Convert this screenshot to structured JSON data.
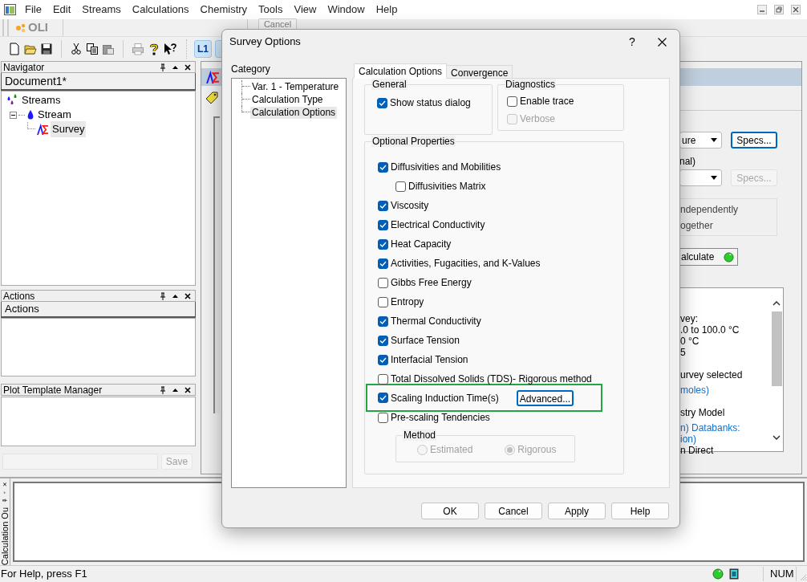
{
  "menu_bar": {
    "items": [
      "File",
      "Edit",
      "Streams",
      "Calculations",
      "Chemistry",
      "Tools",
      "View",
      "Window",
      "Help"
    ]
  },
  "toolbar": {
    "logo": "OLI",
    "cancel_button": {
      "label": "Cancel",
      "disabled": true
    },
    "l1_button": "L1"
  },
  "navigator": {
    "title": "Navigator",
    "tab": "Document1*",
    "tree": [
      {
        "label": "Streams",
        "selected": false,
        "children": [
          {
            "label": "Stream",
            "selected": false,
            "expanded": true,
            "children": [
              {
                "label": "Survey",
                "selected": true
              }
            ]
          }
        ]
      }
    ]
  },
  "actions_panel": {
    "title": "Actions",
    "tab": "Actions"
  },
  "plot_template_manager": {
    "title": "Plot Template Manager",
    "save_button": {
      "label": "Save",
      "disabled": true
    }
  },
  "survey_panel": {
    "dropdown_value": "ure",
    "label": "nal)",
    "specs_buttons": [
      {
        "label": "Specs...",
        "disabled": false
      },
      {
        "label": "Specs...",
        "disabled": true
      }
    ],
    "options": [
      "ndependently",
      "ogether"
    ],
    "calculate_button": "alculate",
    "results": [
      [
        {
          "text": "vey:",
          "kind": "text"
        },
        {
          "text": ".0 to 100.0 °C",
          "kind": "text"
        },
        {
          "text": "0 °C",
          "kind": "text"
        },
        {
          "text": "5",
          "kind": "text"
        }
      ],
      [
        {
          "text": "urvey selected",
          "kind": "text"
        },
        {
          "text": "moles)",
          "kind": "link"
        }
      ],
      [
        {
          "text": "stry Model",
          "kind": "text"
        },
        {
          "text": "n) Databanks:",
          "kind": "link"
        },
        {
          "text": "ion)",
          "kind": "link"
        },
        {
          "text": "n Direct",
          "kind": "text"
        }
      ]
    ]
  },
  "output_pane": {
    "tab": "Calculation Ou"
  },
  "status_bar": {
    "text": "For Help, press F1",
    "indicator": "NUM"
  },
  "dialog": {
    "title": "Survey Options",
    "help_button": "?",
    "category_label": "Category",
    "categories": [
      {
        "label": "Var. 1 - Temperature",
        "selected": false
      },
      {
        "label": "Calculation Type",
        "selected": false
      },
      {
        "label": "Calculation Options",
        "selected": true
      }
    ],
    "tabs": [
      {
        "label": "Calculation Options",
        "selected": true
      },
      {
        "label": "Convergence",
        "selected": false
      }
    ],
    "general": {
      "title": "General",
      "options": [
        {
          "label": "Show status dialog",
          "checked": true,
          "disabled": false
        }
      ]
    },
    "diagnostics": {
      "title": "Diagnostics",
      "options": [
        {
          "label": "Enable trace",
          "checked": false,
          "disabled": false,
          "children": [
            {
              "label": "Verbose",
              "checked": false,
              "disabled": true
            }
          ]
        }
      ]
    },
    "optional_properties": {
      "title": "Optional Properties",
      "items": [
        {
          "label": "Diffusivities and Mobilities",
          "checked": true,
          "highlighted": false,
          "children": [
            {
              "label": "Diffusivities Matrix",
              "checked": false,
              "highlighted": false
            }
          ]
        },
        {
          "label": "Viscosity",
          "checked": true,
          "highlighted": false
        },
        {
          "label": "Electrical Conductivity",
          "checked": true,
          "highlighted": false
        },
        {
          "label": "Heat Capacity",
          "checked": true,
          "highlighted": false
        },
        {
          "label": "Activities, Fugacities, and K-Values",
          "checked": true,
          "highlighted": false
        },
        {
          "label": "Gibbs Free Energy",
          "checked": false,
          "highlighted": false
        },
        {
          "label": "Entropy",
          "checked": false,
          "highlighted": false
        },
        {
          "label": "Thermal Conductivity",
          "checked": true,
          "highlighted": false
        },
        {
          "label": "Surface Tension",
          "checked": true,
          "highlighted": false
        },
        {
          "label": "Interfacial Tension",
          "checked": true,
          "highlighted": false
        },
        {
          "label": "Total Dissolved Solids (TDS)- Rigorous method",
          "checked": false,
          "highlighted": false
        },
        {
          "label": "Scaling Induction Time(s)",
          "checked": true,
          "highlighted": true,
          "button": "Advanced..."
        },
        {
          "label": "Pre-scaling Tendencies",
          "checked": false,
          "highlighted": false
        }
      ],
      "method": {
        "title": "Method",
        "options": [
          {
            "label": "Estimated",
            "selected": false,
            "disabled": true
          },
          {
            "label": "Rigorous",
            "selected": true,
            "disabled": true
          }
        ]
      }
    },
    "buttons": [
      "OK",
      "Cancel",
      "Apply",
      "Help"
    ]
  }
}
